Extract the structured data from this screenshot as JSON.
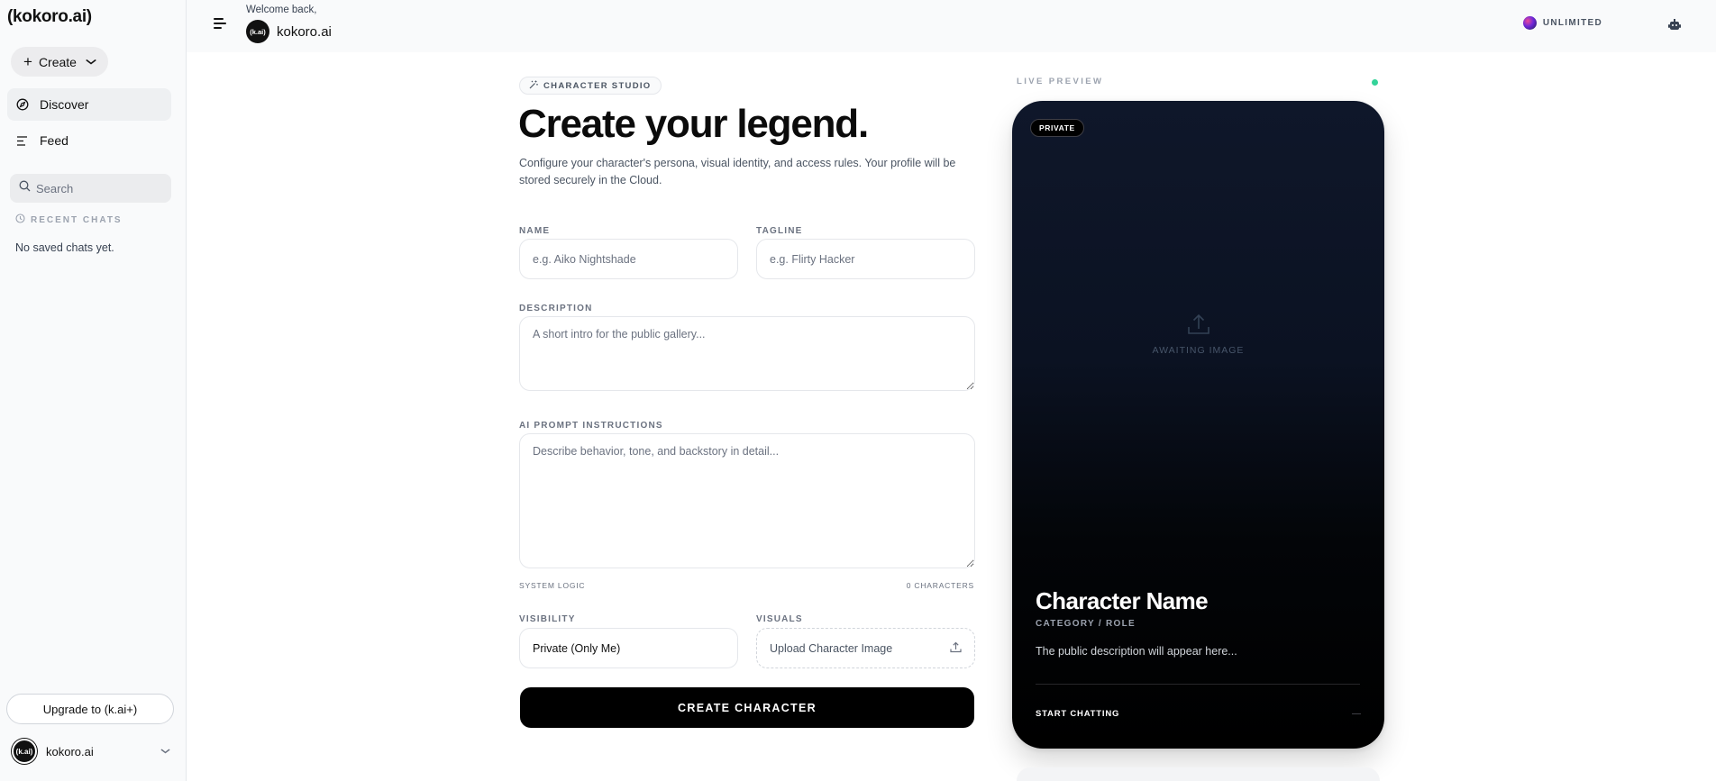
{
  "sidebar": {
    "logo": "(kokoro.ai)",
    "create_label": "Create",
    "nav": [
      {
        "label": "Discover",
        "icon": "compass-icon"
      },
      {
        "label": "Feed",
        "icon": "list-icon"
      }
    ],
    "search_placeholder": "Search",
    "recent_label": "RECENT CHATS",
    "no_chats": "No saved chats yet.",
    "upgrade_label": "Upgrade to (k.ai+)",
    "user_name": "kokoro.ai",
    "avatar_text": "(k.ai)"
  },
  "header": {
    "welcome": "Welcome back,",
    "brand": "kokoro.ai",
    "avatar_text": "(k.ai)",
    "plan": "UNLIMITED"
  },
  "form": {
    "badge": "CHARACTER STUDIO",
    "title": "Create your legend.",
    "subtitle": "Configure your character's persona, visual identity, and access rules. Your profile will be stored securely in the Cloud.",
    "name_label": "NAME",
    "name_placeholder": "e.g. Aiko Nightshade",
    "tagline_label": "TAGLINE",
    "tagline_placeholder": "e.g. Flirty Hacker",
    "description_label": "DESCRIPTION",
    "description_placeholder": "A short intro for the public gallery...",
    "prompt_label": "AI PROMPT INSTRUCTIONS",
    "prompt_placeholder": "Describe behavior, tone, and backstory in detail...",
    "system_logic": "SYSTEM LOGIC",
    "char_count": "0 CHARACTERS",
    "visibility_label": "VISIBILITY",
    "visibility_value": "Private (Only Me)",
    "visuals_label": "VISUALS",
    "upload_label": "Upload Character Image",
    "submit_label": "CREATE CHARACTER"
  },
  "preview": {
    "label": "LIVE PREVIEW",
    "private_badge": "PRIVATE",
    "awaiting": "AWAITING IMAGE",
    "char_name": "Character Name",
    "category": "CATEGORY / ROLE",
    "description": "The public description will appear here...",
    "start_chatting": "START CHATTING"
  },
  "colors": {
    "accent": "#000000",
    "live": "#34d399",
    "sidebar_bg": "#f9fafb"
  }
}
